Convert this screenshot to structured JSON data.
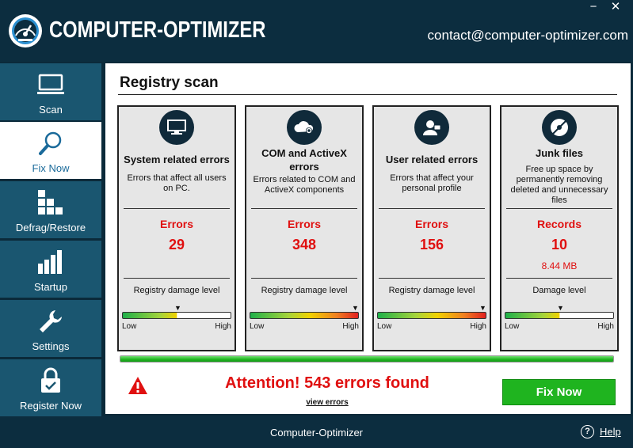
{
  "header": {
    "app_title": "COMPUTER-OPTIMIZER",
    "contact": "contact@computer-optimizer.com",
    "minimize": "−",
    "close": "✕"
  },
  "sidebar": {
    "items": [
      {
        "label": "Scan",
        "icon": "monitor-icon",
        "active": false
      },
      {
        "label": "Fix Now",
        "icon": "magnifier-icon",
        "active": true
      },
      {
        "label": "Defrag/Restore",
        "icon": "blocks-icon",
        "active": false
      },
      {
        "label": "Startup",
        "icon": "bars-icon",
        "active": false
      },
      {
        "label": "Settings",
        "icon": "wrench-icon",
        "active": false
      },
      {
        "label": "Register Now",
        "icon": "lock-icon",
        "active": false
      }
    ]
  },
  "main": {
    "title": "Registry scan",
    "cards": [
      {
        "title": "System related errors",
        "description": "Errors that affect all users on PC.",
        "metric_label": "Errors",
        "metric_value": "29",
        "damage_label": "Registry damage level",
        "low": "Low",
        "high": "High",
        "icon": "monitor-icon",
        "damage_level": 0.5
      },
      {
        "title": "COM and ActiveX errors",
        "description": "Errors related to COM and ActiveX components",
        "metric_label": "Errors",
        "metric_value": "348",
        "damage_label": "Registry damage level",
        "low": "Low",
        "high": "High",
        "icon": "cloud-gear-icon",
        "damage_level": 0.98
      },
      {
        "title": "User related errors",
        "description": "Errors that affect your personal profile",
        "metric_label": "Errors",
        "metric_value": "156",
        "damage_label": "Registry damage level",
        "low": "Low",
        "high": "High",
        "icon": "user-icon",
        "damage_level": 0.98
      },
      {
        "title": "Junk files",
        "description": "Free up space by permanently removing deleted and unnecessary files",
        "metric_label": "Records",
        "metric_value": "10",
        "metric_size": "8.44 MB",
        "damage_label": "Damage level",
        "low": "Low",
        "high": "High",
        "icon": "disc-icon",
        "damage_level": 0.5
      }
    ],
    "progress": 1.0,
    "attention": "Attention! 543 errors found",
    "view_errors": "view errors",
    "fix_now": "Fix Now"
  },
  "footer": {
    "title": "Computer-Optimizer",
    "help_icon": "?",
    "help": "Help"
  },
  "colors": {
    "header_bg": "#0c2d3f",
    "nav_bg": "#1a5670",
    "error_red": "#e01010",
    "fix_green": "#1fb41f"
  }
}
